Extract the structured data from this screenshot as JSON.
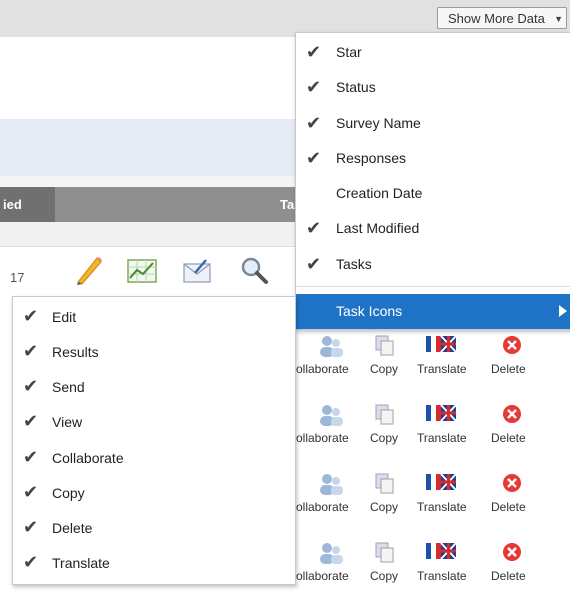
{
  "toolbar": {
    "show_more_label": "Show More Data"
  },
  "table": {
    "header_left": "ied",
    "header_right": "Ta",
    "row_number": "17"
  },
  "show_more_menu": {
    "items": [
      {
        "label": "Star",
        "checked": true
      },
      {
        "label": "Status",
        "checked": true
      },
      {
        "label": "Survey Name",
        "checked": true
      },
      {
        "label": "Responses",
        "checked": true
      },
      {
        "label": "Creation Date",
        "checked": false
      },
      {
        "label": "Last Modified",
        "checked": true
      },
      {
        "label": "Tasks",
        "checked": true
      }
    ],
    "task_icons_label": "Task Icons"
  },
  "task_icons_submenu": {
    "items": [
      {
        "label": "Edit",
        "checked": true
      },
      {
        "label": "Results",
        "checked": true
      },
      {
        "label": "Send",
        "checked": true
      },
      {
        "label": "View",
        "checked": true
      },
      {
        "label": "Collaborate",
        "checked": true
      },
      {
        "label": "Copy",
        "checked": true
      },
      {
        "label": "Delete",
        "checked": true
      },
      {
        "label": "Translate",
        "checked": true
      }
    ]
  },
  "task_grid": {
    "labels": [
      "ollaborate",
      "Copy",
      "Translate",
      "Delete"
    ]
  },
  "colors": {
    "highlight": "#1f73c7",
    "delete_red": "#e53935"
  }
}
